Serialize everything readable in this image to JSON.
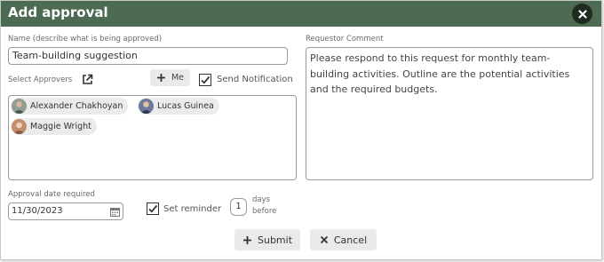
{
  "dialog": {
    "title": "Add approval",
    "close_icon": "close-icon"
  },
  "name_field": {
    "label": "Name (describe what is being approved)",
    "value": "Team-building suggestion"
  },
  "approvers": {
    "label": "Select Approvers",
    "open_icon": "external-link-icon",
    "me_label": "Me",
    "send_notification_label": "Send Notification",
    "send_notification_checked": true,
    "chips": [
      {
        "name": "Alexander Chakhoyan",
        "avatar_color": "#7a8a7e"
      },
      {
        "name": "Lucas Guinea",
        "avatar_color": "#5b6b8a"
      },
      {
        "name": "Maggie Wright",
        "avatar_color": "#c9a68e"
      }
    ]
  },
  "comment": {
    "label": "Requestor Comment",
    "text": "Please respond to this request for monthly team-building activities. Outline are the potential activities and the required budgets."
  },
  "date": {
    "label": "Approval date required",
    "value": "11/30/2023",
    "calendar_icon": "calendar-icon"
  },
  "reminder": {
    "label": "Set reminder",
    "checked": true,
    "days_value": "1",
    "days_label_line1": "days",
    "days_label_line2": "before"
  },
  "buttons": {
    "submit_label": "Submit",
    "cancel_label": "Cancel"
  },
  "colors": {
    "titlebar": "#4d6b52",
    "close_button": "#1d2b21"
  }
}
